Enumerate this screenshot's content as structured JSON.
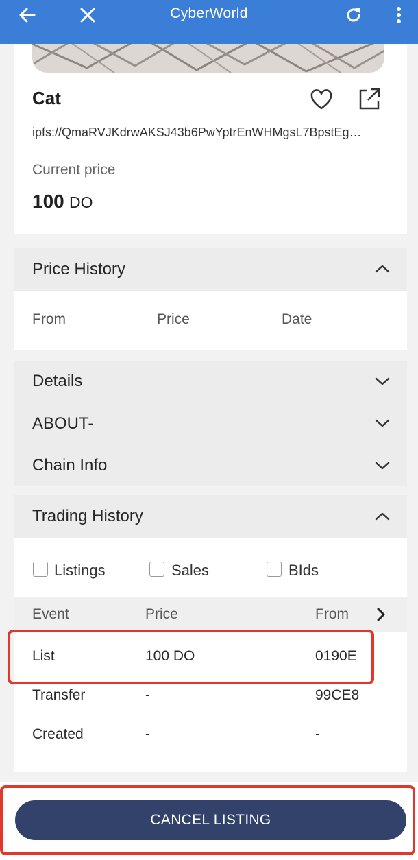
{
  "app": {
    "title": "CyberWorld"
  },
  "nft": {
    "title": "Cat",
    "ipfs": "ipfs://QmaRVJKdrwAKSJ43b6PwYptrEnWHMgsL7BpstEg…",
    "price_label": "Current price",
    "price_value": "100",
    "price_currency": "DO"
  },
  "price_history": {
    "label": "Price History",
    "columns": [
      "From",
      "Price",
      "Date"
    ]
  },
  "details": {
    "label": "Details"
  },
  "about": {
    "label": "ABOUT-"
  },
  "chain_info": {
    "label": "Chain Info"
  },
  "trading_history": {
    "label": "Trading History",
    "filters": [
      "Listings",
      "Sales",
      "BIds"
    ],
    "columns": [
      "Event",
      "Price",
      "From"
    ],
    "rows": [
      {
        "event": "List",
        "price": "100 DO",
        "from": "0190E"
      },
      {
        "event": "Transfer",
        "price": "-",
        "from": "99CE8"
      },
      {
        "event": "Created",
        "price": "-",
        "from": "-"
      }
    ]
  },
  "actions": {
    "cancel_label": "CANCEL LISTING"
  },
  "colors": {
    "topbar": "#3b7ed8",
    "button": "#33426a",
    "highlight": "#e2382b"
  }
}
